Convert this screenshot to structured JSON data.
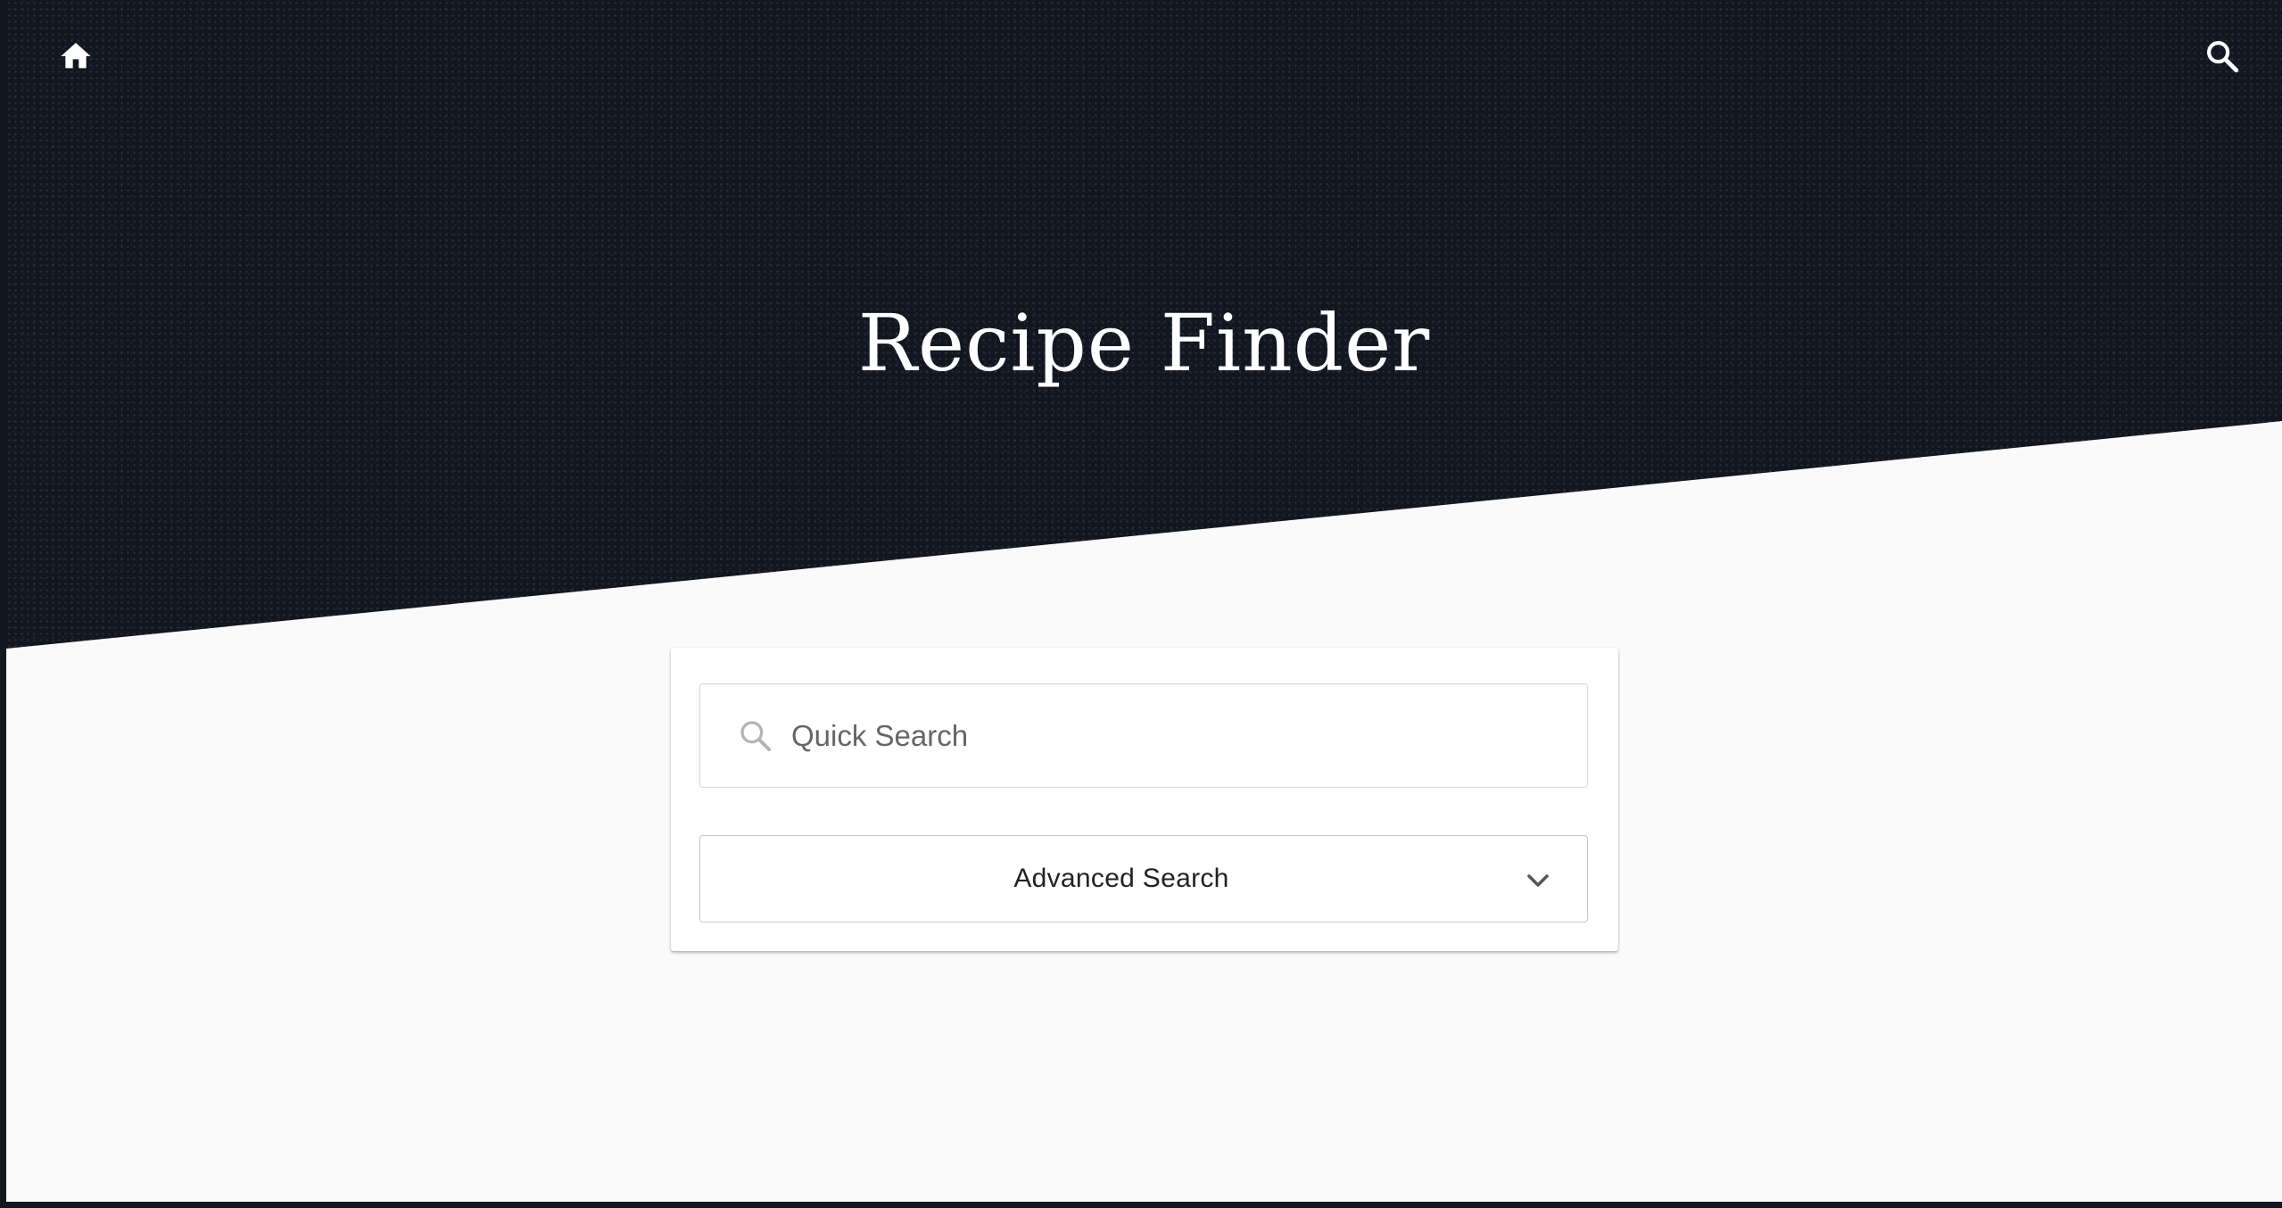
{
  "header": {
    "title": "Recipe Finder",
    "home_icon": "home-icon",
    "search_icon": "search-icon"
  },
  "search_card": {
    "quick_search": {
      "placeholder": "Quick Search",
      "value": "",
      "icon": "search-icon"
    },
    "advanced_search": {
      "label": "Advanced Search",
      "icon": "chevron-down-icon",
      "expanded": false
    }
  },
  "colors": {
    "hero_background": "#111620",
    "page_background": "#fafafa",
    "card_background": "#ffffff",
    "title_text": "#ffffff"
  }
}
